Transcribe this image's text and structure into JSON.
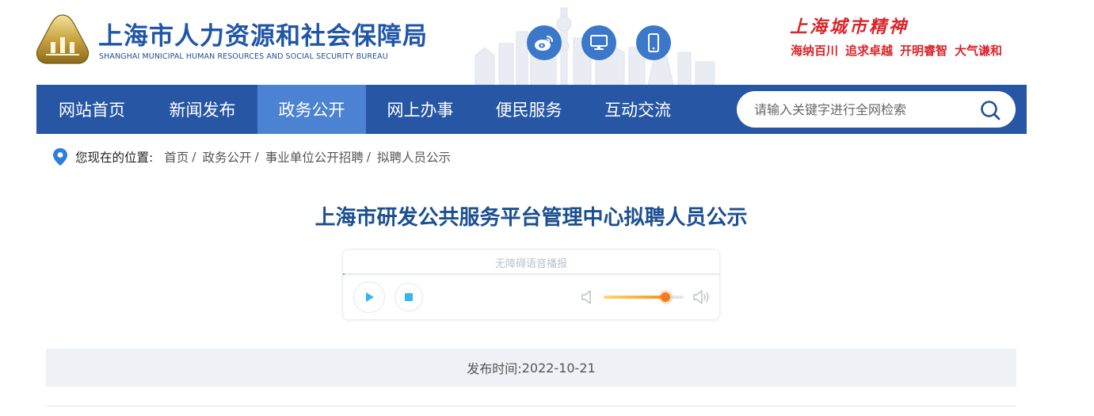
{
  "header": {
    "title": "上海市人力资源和社会保障局",
    "subtitle": "SHANGHAI MUNICIPAL HUMAN RESOURCES AND SOCIAL SECURITY BUREAU",
    "spirit_title": "上海城市精神",
    "spirit_words": [
      "海纳百川",
      "追求卓越",
      "开明睿智",
      "大气谦和"
    ],
    "icons": [
      "weibo-icon",
      "desktop-icon",
      "mobile-icon"
    ]
  },
  "nav": {
    "items": [
      {
        "label": "网站首页"
      },
      {
        "label": "新闻发布"
      },
      {
        "label": "政务公开"
      },
      {
        "label": "网上办事"
      },
      {
        "label": "便民服务"
      },
      {
        "label": "互动交流"
      }
    ],
    "active_index": 2
  },
  "search": {
    "placeholder": "请输入关键字进行全网检索",
    "value": ""
  },
  "breadcrumb": {
    "label": "您现在的位置:",
    "items": [
      "首页",
      "政务公开",
      "事业单位公开招聘",
      "拟聘人员公示"
    ]
  },
  "article": {
    "title": "上海市研发公共服务平台管理中心拟聘人员公示",
    "publish_label": "发布时间:",
    "publish_date": "2022-10-21"
  },
  "audio_player": {
    "title": "无障碍语音播报",
    "progress": 0.003,
    "volume": 0.77
  },
  "colors": {
    "brand_blue": "#2656a4",
    "nav_active": "#4b82d1",
    "title_blue": "#1b4f90",
    "spirit_red": "#d9252b",
    "accent_cyan": "#36b5ee",
    "volume_orange": "#f47a1f"
  }
}
